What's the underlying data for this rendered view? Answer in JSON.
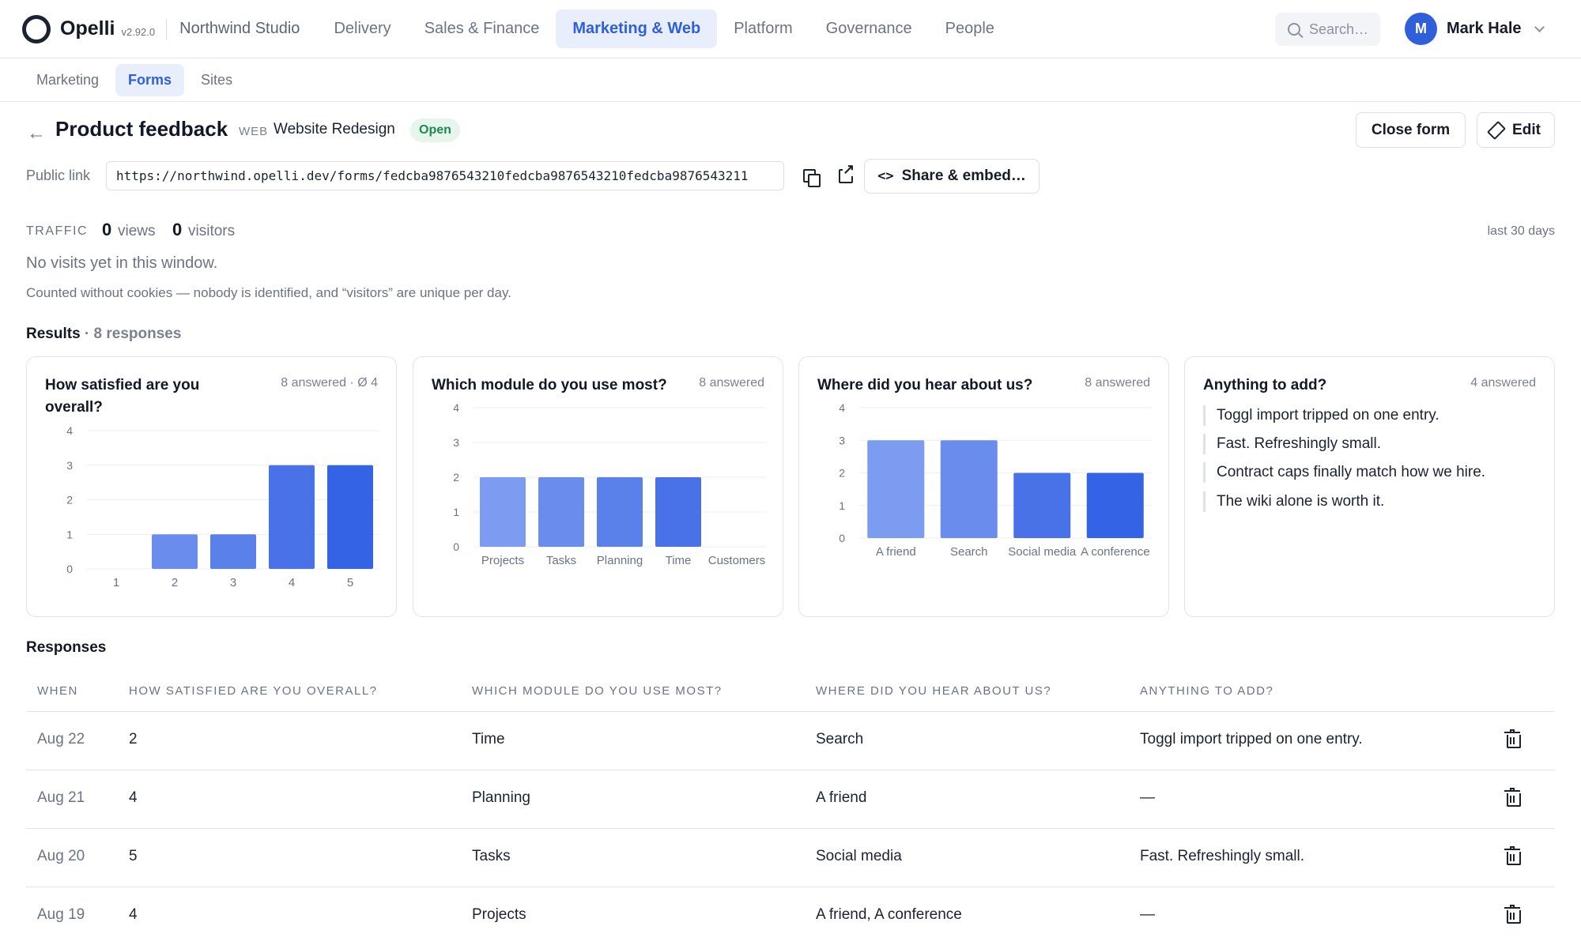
{
  "brand": {
    "name": "Opelli",
    "version": "v2.92.0",
    "workspace": "Northwind Studio"
  },
  "nav": [
    {
      "label": "Delivery",
      "active": false
    },
    {
      "label": "Sales & Finance",
      "active": false
    },
    {
      "label": "Marketing & Web",
      "active": true
    },
    {
      "label": "Platform",
      "active": false
    },
    {
      "label": "Governance",
      "active": false
    },
    {
      "label": "People",
      "active": false
    }
  ],
  "search": {
    "placeholder": "Search…"
  },
  "user": {
    "initial": "M",
    "name": "Mark Hale"
  },
  "subnav": [
    {
      "label": "Marketing",
      "active": false
    },
    {
      "label": "Forms",
      "active": true
    },
    {
      "label": "Sites",
      "active": false
    }
  ],
  "form": {
    "title": "Product feedback",
    "tag": "WEB",
    "project": "Website Redesign",
    "status": "Open",
    "close_label": "Close form",
    "edit_label": "Edit"
  },
  "public_link": {
    "label": "Public link",
    "url": "https://northwind.opelli.dev/forms/fedcba9876543210fedcba9876543210fedcba9876543211",
    "share_label": "Share & embed…"
  },
  "traffic": {
    "label": "TRAFFIC",
    "views": "0",
    "views_unit": "views",
    "visitors": "0",
    "visitors_unit": "visitors",
    "period": "last 30 days",
    "empty": "No visits yet in this window.",
    "note": "Counted without cookies — nobody is identified, and “visitors” are unique per day."
  },
  "results": {
    "label": "Results",
    "count": "· 8 responses"
  },
  "chart_data": [
    {
      "type": "bar",
      "title": "How satisfied are you overall?",
      "meta": "8 answered · Ø 4",
      "categories": [
        "1",
        "2",
        "3",
        "4",
        "5"
      ],
      "values": [
        0,
        1,
        1,
        3,
        3
      ],
      "yticks": [
        "0",
        "1",
        "2",
        "3",
        "4"
      ],
      "ylim": [
        0,
        4
      ]
    },
    {
      "type": "bar",
      "title": "Which module do you use most?",
      "meta": "8 answered",
      "categories": [
        "Projects",
        "Tasks",
        "Planning",
        "Time",
        "Customers"
      ],
      "values": [
        2,
        2,
        2,
        2,
        0
      ],
      "yticks": [
        "0",
        "1",
        "2",
        "3",
        "4"
      ],
      "ylim": [
        0,
        4
      ]
    },
    {
      "type": "bar",
      "title": "Where did you hear about us?",
      "meta": "8 answered",
      "categories": [
        "A friend",
        "Search",
        "Social media",
        "A conference"
      ],
      "values": [
        3,
        3,
        2,
        2
      ],
      "yticks": [
        "0",
        "1",
        "2",
        "3",
        "4"
      ],
      "ylim": [
        0,
        4
      ]
    }
  ],
  "comments_card": {
    "title": "Anything to add?",
    "meta": "4 answered",
    "items": [
      "Toggl import tripped on one entry.",
      "Fast. Refreshingly small.",
      "Contract caps finally match how we hire.",
      "The wiki alone is worth it."
    ]
  },
  "responses": {
    "label": "Responses",
    "columns": [
      "WHEN",
      "HOW SATISFIED ARE YOU OVERALL?",
      "WHICH MODULE DO YOU USE MOST?",
      "WHERE DID YOU HEAR ABOUT US?",
      "ANYTHING TO ADD?"
    ],
    "rows": [
      {
        "when": "Aug 22",
        "satisfied": "2",
        "module": "Time",
        "source": "Search",
        "add": "Toggl import tripped on one entry."
      },
      {
        "when": "Aug 21",
        "satisfied": "4",
        "module": "Planning",
        "source": "A friend",
        "add": "—"
      },
      {
        "when": "Aug 20",
        "satisfied": "5",
        "module": "Tasks",
        "source": "Social media",
        "add": "Fast. Refreshingly small."
      },
      {
        "when": "Aug 19",
        "satisfied": "4",
        "module": "Projects",
        "source": "A friend, A conference",
        "add": "—"
      }
    ]
  },
  "colors": {
    "accent": "#2f5fd9",
    "bars": [
      "#7b9cf0",
      "#6a8ded",
      "#5a80ea",
      "#4a72e8",
      "#3563e6"
    ]
  }
}
